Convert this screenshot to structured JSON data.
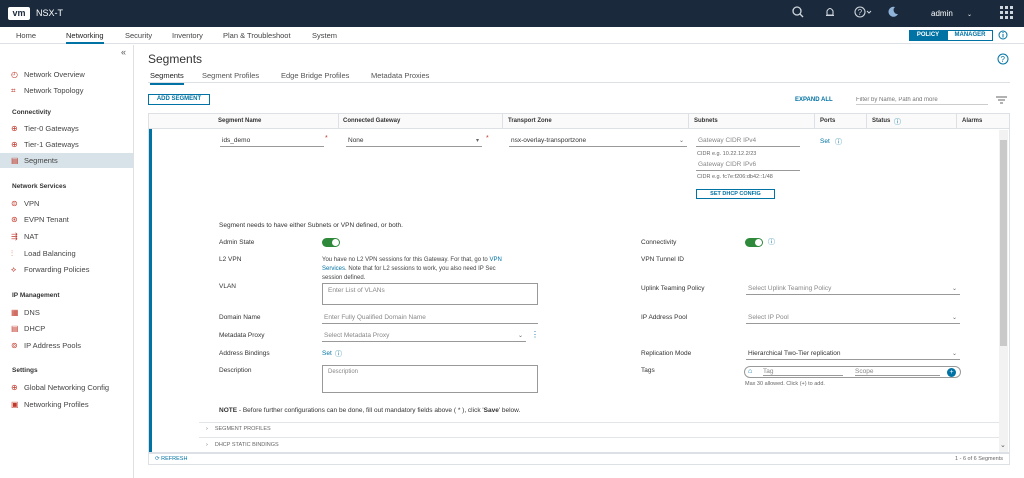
{
  "header": {
    "logo": "vm",
    "title": "NSX-T",
    "user": "admin",
    "icons": [
      "search-icon",
      "bell-icon",
      "help-icon",
      "moon-icon",
      "apps-grid-icon"
    ]
  },
  "nav": {
    "tabs": [
      "Home",
      "Networking",
      "Security",
      "Inventory",
      "Plan & Troubleshoot",
      "System"
    ],
    "active": "Networking",
    "policy_label": "POLICY",
    "manager_label": "MANAGER"
  },
  "sidebar": {
    "collapse": "«",
    "top_items": [
      {
        "label": "Network Overview",
        "icon": "network-overview-icon"
      },
      {
        "label": "Network Topology",
        "icon": "network-topology-icon"
      }
    ],
    "connectivity": {
      "title": "Connectivity",
      "items": [
        {
          "label": "Tier-0 Gateways",
          "icon": "tier0-gateway-icon"
        },
        {
          "label": "Tier-1 Gateways",
          "icon": "tier1-gateway-icon"
        },
        {
          "label": "Segments",
          "icon": "segments-icon"
        }
      ]
    },
    "network_services": {
      "title": "Network Services",
      "items": [
        {
          "label": "VPN",
          "icon": "vpn-icon"
        },
        {
          "label": "EVPN Tenant",
          "icon": "evpn-icon"
        },
        {
          "label": "NAT",
          "icon": "nat-icon"
        },
        {
          "label": "Load Balancing",
          "icon": "load-balancing-icon"
        },
        {
          "label": "Forwarding Policies",
          "icon": "forwarding-icon"
        }
      ]
    },
    "ip_management": {
      "title": "IP Management",
      "items": [
        {
          "label": "DNS",
          "icon": "dns-icon"
        },
        {
          "label": "DHCP",
          "icon": "dhcp-icon"
        },
        {
          "label": "IP Address Pools",
          "icon": "ip-pool-icon"
        }
      ]
    },
    "settings": {
      "title": "Settings",
      "items": [
        {
          "label": "Global Networking Config",
          "icon": "global-config-icon"
        },
        {
          "label": "Networking Profiles",
          "icon": "profiles-icon"
        }
      ]
    }
  },
  "page": {
    "title": "Segments",
    "subtabs": [
      "Segments",
      "Segment Profiles",
      "Edge Bridge Profiles",
      "Metadata Proxies"
    ],
    "add_label": "ADD SEGMENT",
    "expand_all": "EXPAND ALL",
    "filter_placeholder": "Filter by Name, Path and more"
  },
  "grid": {
    "columns": [
      "Segment Name",
      "Connected Gateway",
      "Transport Zone",
      "Subnets",
      "Ports",
      "Status",
      "Alarms"
    ],
    "row": {
      "name": "ids_demo",
      "gateway": "None",
      "transport_zone": "nsx-overlay-transportzone",
      "gw_cidr_v4": "Gateway CIDR IPv4",
      "cidr_v4_eg": "CIDR e.g. 10.22.12.2/23",
      "gw_cidr_v6": "Gateway CIDR IPv6",
      "cidr_v6_eg": "CIDR e.g. fc7e:f206:db42::1/48",
      "dhcp_btn": "SET DHCP CONFIG",
      "ports": "Set"
    },
    "detail": {
      "notice": "Segment needs to have either Subnets or VPN defined, or both.",
      "admin_state": "Admin State",
      "connectivity": "Connectivity",
      "l2vpn": "L2 VPN",
      "l2vpn_text1": "You have no L2 VPN sessions for this Gateway. For that, go to",
      "l2vpn_link1": "VPN",
      "l2vpn_link2": "Services",
      "l2vpn_text2": ". Note that for L2 sessions to work, you also need IP Sec",
      "l2vpn_text3": "session defined.",
      "vpn_tunnel_id": "VPN Tunnel ID",
      "vlan": "VLAN",
      "vlan_ph": "Enter List of VLANs",
      "uplink_policy": "Uplink Teaming Policy",
      "uplink_ph": "Select Uplink Teaming Policy",
      "domain_name": "Domain Name",
      "domain_ph": "Enter Fully Qualified Domain Name",
      "ip_pool": "IP Address Pool",
      "ip_pool_ph": "Select IP Pool",
      "metadata_proxy": "Metadata Proxy",
      "metadata_ph": "Select Metadata Proxy",
      "address_bindings": "Address Bindings",
      "address_set": "Set",
      "replication_mode": "Replication Mode",
      "replication_value": "Hierarchical Two-Tier replication",
      "description": "Description",
      "description_ph": "Description",
      "tags": "Tags",
      "tag_ph": "Tag",
      "scope_ph": "Scope",
      "tags_note": "Max 30 allowed. Click (+) to add.",
      "note_label": "NOTE",
      "note_text": " - Before further configurations can be done, fill out mandatory fields above ( * ), click '",
      "note_save": "Save",
      "note_end": "' below.",
      "segment_profiles": "SEGMENT PROFILES",
      "dhcp_bindings": "DHCP STATIC BINDINGS"
    }
  },
  "footer": {
    "refresh": "REFRESH",
    "count": "1 - 6 of 6 Segments"
  }
}
